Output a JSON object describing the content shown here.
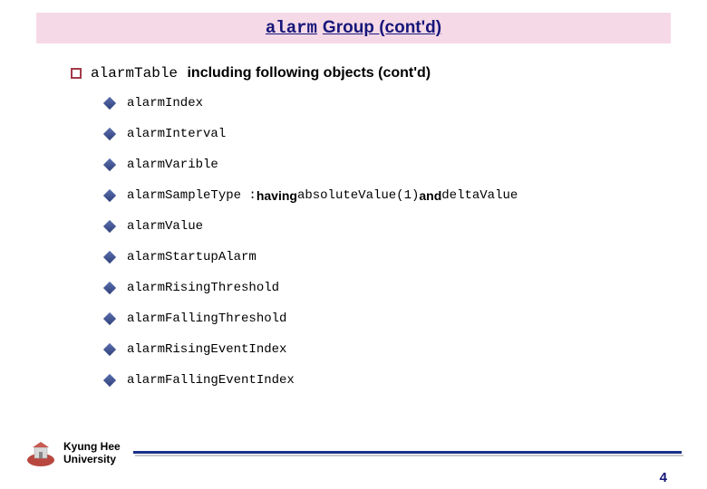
{
  "title": {
    "mono": "alarm",
    "rest": "Group (cont'd)"
  },
  "main": {
    "mono": "alarmTable",
    "rest": "including following objects (cont'd)"
  },
  "items": [
    {
      "text": "alarmIndex"
    },
    {
      "text": "alarmInterval"
    },
    {
      "text": "alarmVarible"
    },
    {
      "text": "alarmSampleType : ",
      "having": "having",
      "mid1": " absoluteValue(1) ",
      "and": "and",
      "mid2": " deltaValue"
    },
    {
      "text": "alarmValue"
    },
    {
      "text": "alarmStartupAlarm"
    },
    {
      "text": "alarmRisingThreshold"
    },
    {
      "text": "alarmFallingThreshold"
    },
    {
      "text": "alarmRisingEventIndex"
    },
    {
      "text": "alarmFallingEventIndex"
    }
  ],
  "footer": {
    "uni1": "Kyung Hee",
    "uni2": "University",
    "page": "4"
  }
}
